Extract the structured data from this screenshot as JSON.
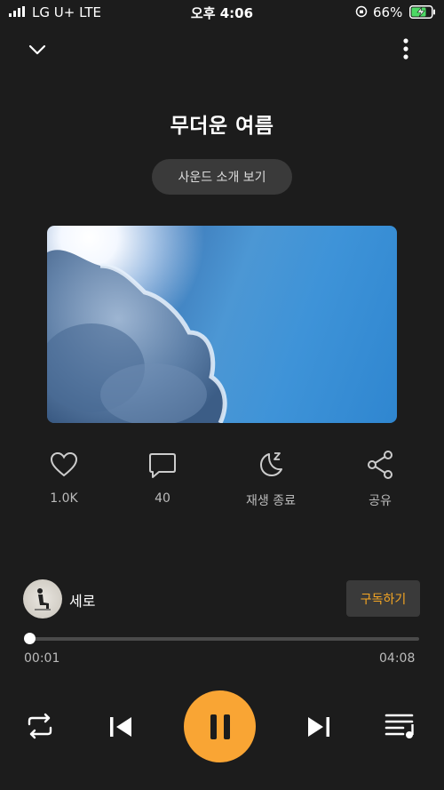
{
  "status_bar": {
    "carrier": "LG U+  LTE",
    "time": "오후 4:06",
    "battery": "66%"
  },
  "header": {
    "title": "무더운 여름",
    "intro_button": "사운드 소개 보기"
  },
  "actions": {
    "like_count": "1.0K",
    "comment_count": "40",
    "sleep_timer_label": "재생 종료",
    "share_label": "공유"
  },
  "artist": {
    "name": "세로",
    "subscribe_label": "구독하기"
  },
  "playback": {
    "current_time": "00:01",
    "total_time": "04:08",
    "progress": 0.004,
    "state": "playing"
  },
  "colors": {
    "accent": "#f9a534",
    "background": "#1c1c1c",
    "subscribe_text": "#f5a623"
  },
  "icons": [
    "chevron-down-icon",
    "more-vertical-icon",
    "heart-icon",
    "comment-icon",
    "moon-sleep-icon",
    "share-icon",
    "repeat-icon",
    "previous-icon",
    "pause-icon",
    "next-icon",
    "playlist-icon"
  ]
}
